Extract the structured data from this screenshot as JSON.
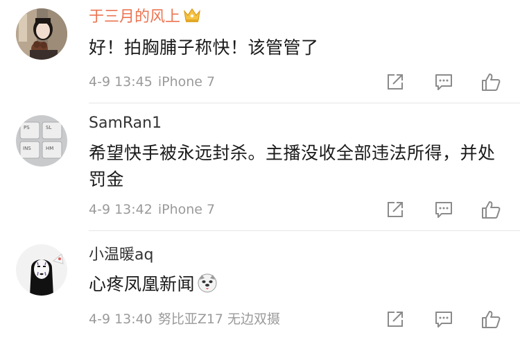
{
  "comments": [
    {
      "username": "于三月的风上",
      "vip": true,
      "text": "好！拍胸脯子称快！该管管了",
      "time": "4-9 13:45",
      "device": "iPhone 7",
      "avatar": "avatar-girl-with-dog",
      "icons": [
        "crown-icon",
        "share-icon",
        "comment-icon",
        "like-icon"
      ]
    },
    {
      "username": "SamRan1",
      "vip": false,
      "text": "希望快手被永远封杀。主播没收全部违法所得，并处罚金",
      "time": "4-9 13:42",
      "device": "iPhone 7",
      "avatar": "avatar-keyboard-keys",
      "avatar_keys": [
        "PS",
        "SL",
        "INS",
        "HM"
      ],
      "icons": [
        "share-icon",
        "comment-icon",
        "like-icon"
      ]
    },
    {
      "username": "小温暖aq",
      "vip": false,
      "text": "心疼凤凰新闻",
      "time": "4-9 13:40",
      "device": "努比亚Z17 无边双摄",
      "avatar": "avatar-no-face",
      "icons": [
        "doge-emoji-icon",
        "share-icon",
        "comment-icon",
        "like-icon"
      ]
    }
  ],
  "colors": {
    "vip_name": "#eb7350",
    "meta_text": "#9a9a9a",
    "icon_gray": "#8a8a8a",
    "divider": "#e6e6e6"
  }
}
